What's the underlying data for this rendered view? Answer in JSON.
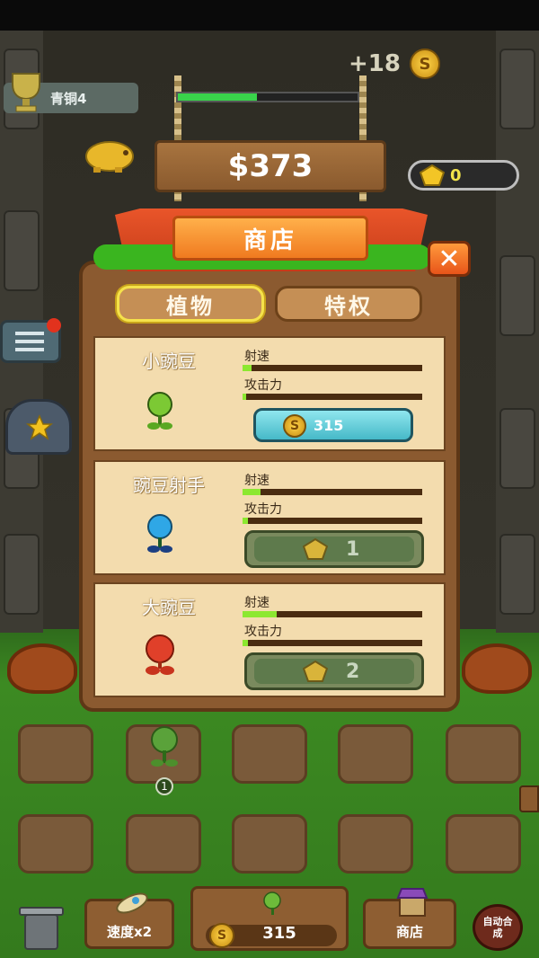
{
  "hud": {
    "trophy_rank": "青铜4",
    "coins_gain": "+18",
    "money": "$373",
    "gems": "0"
  },
  "shop": {
    "title": "商店",
    "close_glyph": "✕",
    "tabs": [
      {
        "label": "植物",
        "active": true
      },
      {
        "label": "特权",
        "active": false
      }
    ],
    "stat_labels": {
      "speed": "射速",
      "attack": "攻击力"
    },
    "items": [
      {
        "name": "小豌豆",
        "speed_level": 0.05,
        "attack_level": 0.02,
        "price": "315",
        "currency": "coin",
        "color": "#7cc934"
      },
      {
        "name": "豌豆射手",
        "speed_level": 0.1,
        "attack_level": 0.03,
        "price": "1",
        "currency": "gem",
        "color": "#2fa7e6"
      },
      {
        "name": "大豌豆",
        "speed_level": 0.19,
        "attack_level": 0.03,
        "price": "2",
        "currency": "gem",
        "color": "#e0402a"
      }
    ]
  },
  "field": {
    "seedling_level": "1"
  },
  "bottom_bar": {
    "speed_label": "速度x2",
    "buy_price": "315",
    "shop_label": "商店",
    "auto_label": "自动合成"
  }
}
